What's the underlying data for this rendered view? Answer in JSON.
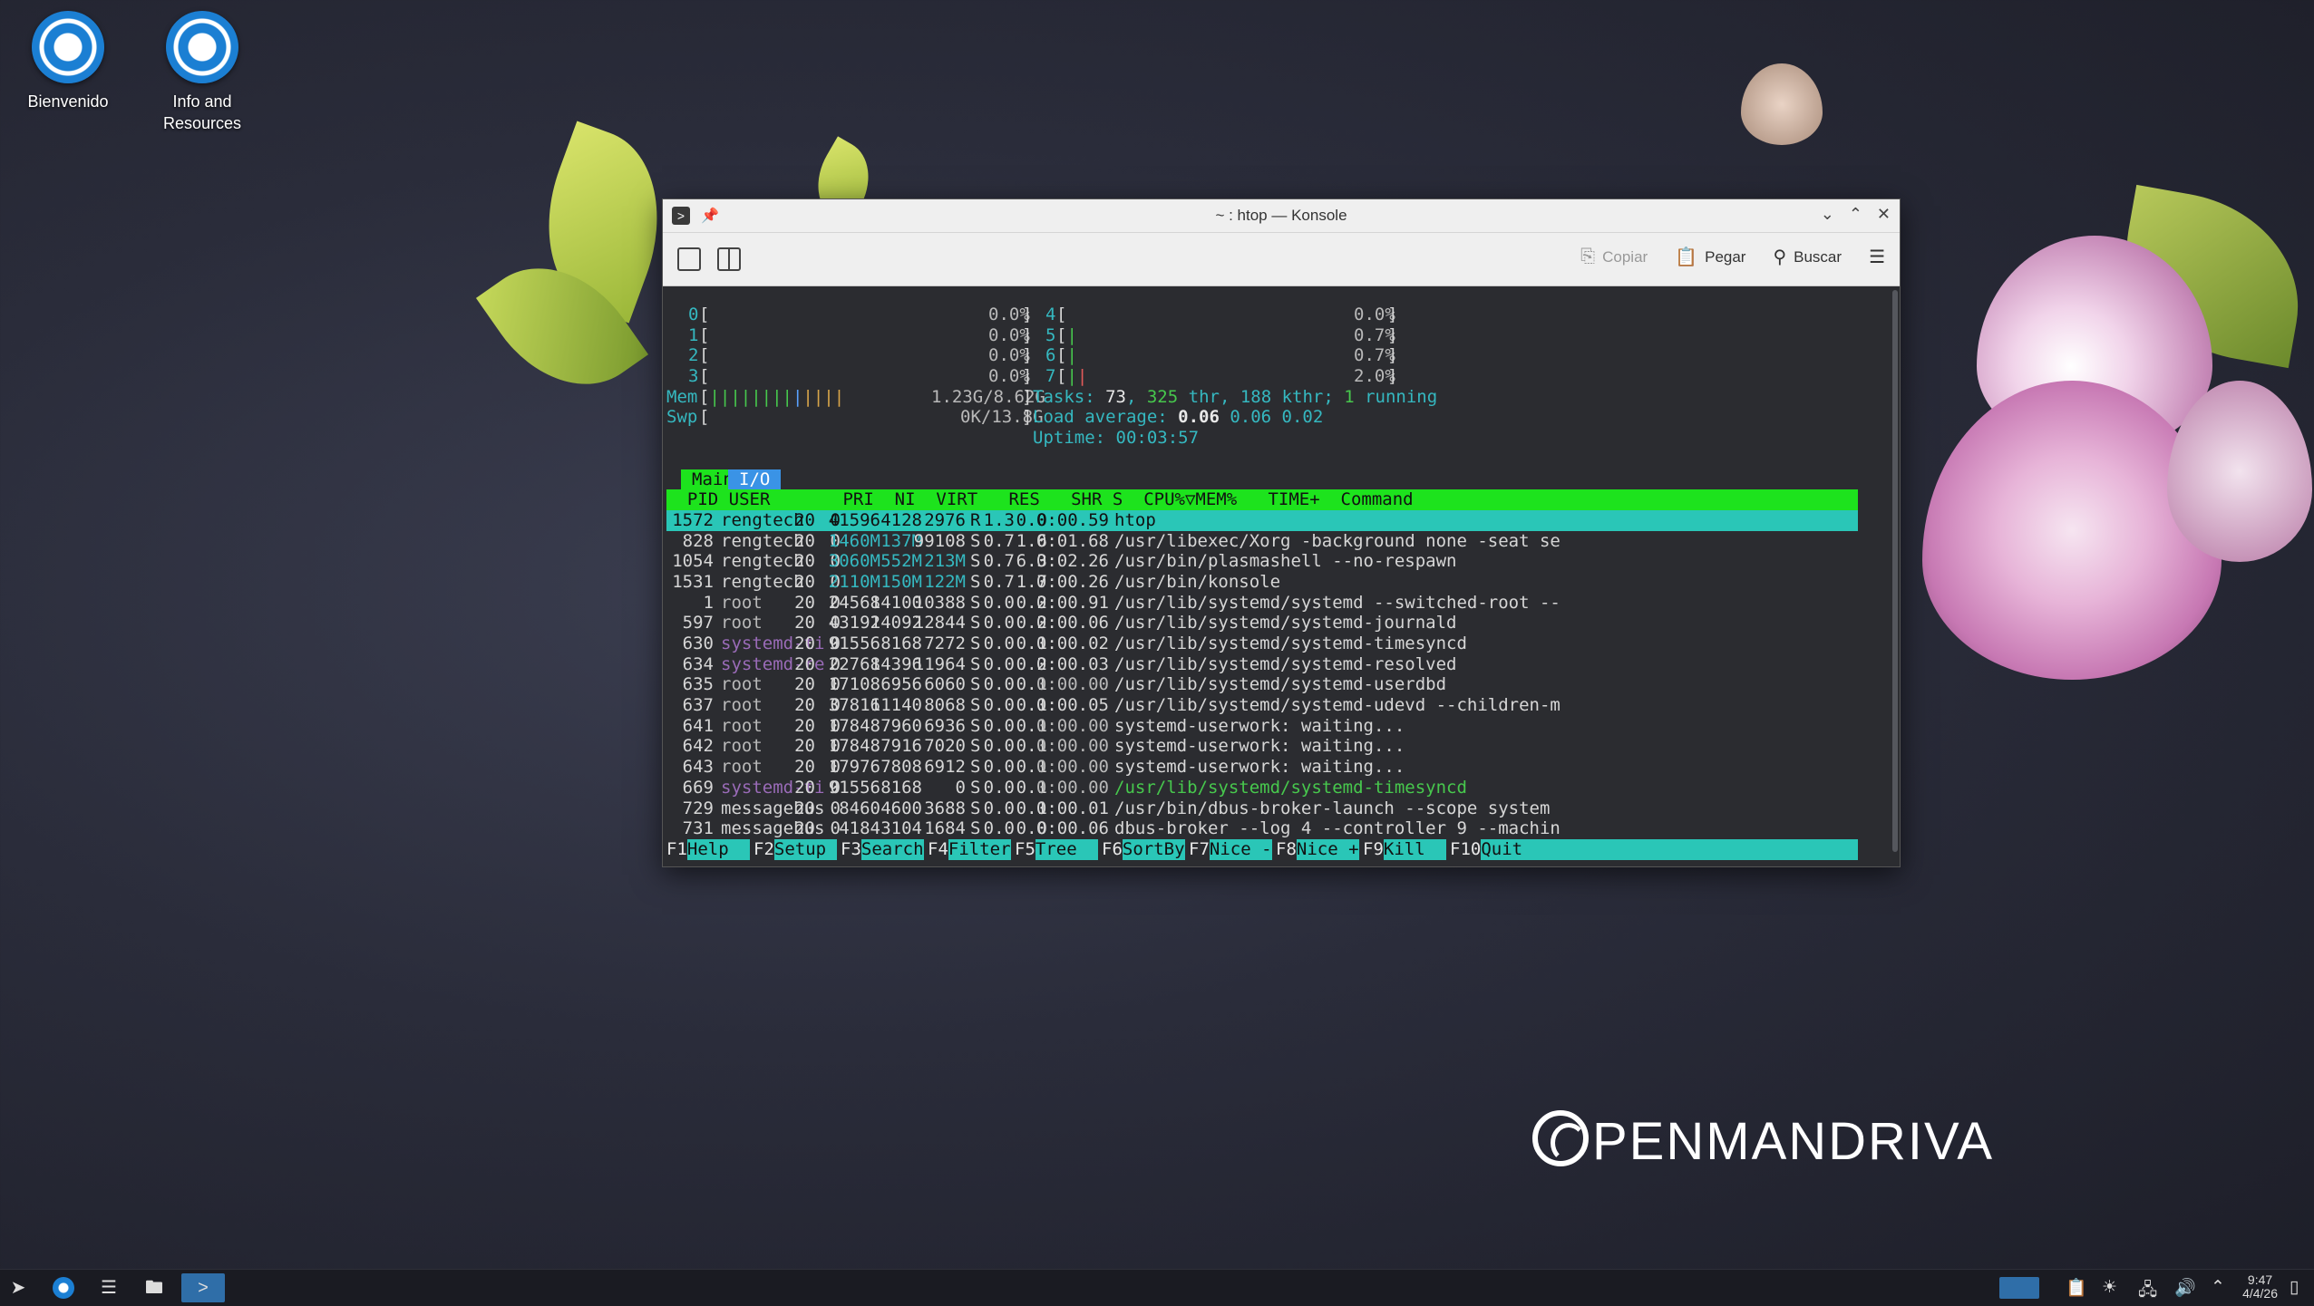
{
  "desktop": {
    "icons": [
      {
        "label": "Bienvenido",
        "icon": "openmandriva-icon"
      },
      {
        "label": "Info and\nResources",
        "icon": "openmandriva-icon"
      }
    ],
    "logo_text": "PENMANDRIVA"
  },
  "window": {
    "title": "~ : htop — Konsole",
    "toolbar": {
      "copy_label": "Copiar",
      "paste_label": "Pegar",
      "search_label": "Buscar"
    }
  },
  "htop": {
    "cpus": [
      {
        "id": "0",
        "pct": "0.0%"
      },
      {
        "id": "1",
        "pct": "0.0%"
      },
      {
        "id": "2",
        "pct": "0.0%"
      },
      {
        "id": "3",
        "pct": "0.0%"
      },
      {
        "id": "4",
        "pct": "0.0%"
      },
      {
        "id": "5",
        "pct": "0.7%"
      },
      {
        "id": "6",
        "pct": "0.7%"
      },
      {
        "id": "7",
        "pct": "2.0%"
      }
    ],
    "mem_label": "Mem",
    "mem_value": "1.23G/8.62G",
    "swp_label": "Swp",
    "swp_value": "0K/13.8G",
    "tasks_prefix": "Tasks: ",
    "tasks_count": "73",
    "thr_count": "325",
    "thr_label": " thr, ",
    "kthr_text": "188 kthr; ",
    "running_count": "1",
    "running_label": " running",
    "load_label": "Load average: ",
    "load_1": "0.06",
    "load_rest": " 0.06 0.02",
    "uptime_label": "Uptime: ",
    "uptime_value": "00:03:57",
    "tabs": [
      "Main",
      "I/O"
    ],
    "header": "  PID USER       PRI  NI  VIRT   RES   SHR S  CPU%▽MEM%   TIME+  Command",
    "processes": [
      {
        "pid": "1572",
        "user": "rengtech",
        "pri": "20",
        "ni": "0",
        "virt": "41596",
        "res": "4128",
        "shr": "2976",
        "s": "R",
        "cpu": "1.3",
        "mem": "0.0",
        "time": "0:00.59",
        "cmd": "htop"
      },
      {
        "pid": "828",
        "user": "rengtech",
        "pri": "20",
        "ni": "0",
        "virt": "1460M",
        "res": "137M",
        "shr": "99108",
        "s": "S",
        "cpu": "0.7",
        "mem": "1.6",
        "time": "0:01.68",
        "cmd": "/usr/libexec/Xorg -background none -seat se"
      },
      {
        "pid": "1054",
        "user": "rengtech",
        "pri": "20",
        "ni": "0",
        "virt": "3060M",
        "res": "552M",
        "shr": "213M",
        "s": "S",
        "cpu": "0.7",
        "mem": "6.3",
        "time": "0:02.26",
        "cmd": "/usr/bin/plasmashell --no-respawn"
      },
      {
        "pid": "1531",
        "user": "rengtech",
        "pri": "20",
        "ni": "0",
        "virt": "2110M",
        "res": "150M",
        "shr": "122M",
        "s": "S",
        "cpu": "0.7",
        "mem": "1.7",
        "time": "0:00.26",
        "cmd": "/usr/bin/konsole"
      },
      {
        "pid": "1",
        "user": "root",
        "pri": "20",
        "ni": "0",
        "virt": "24568",
        "res": "14100",
        "shr": "10388",
        "s": "S",
        "cpu": "0.0",
        "mem": "0.2",
        "time": "0:00.91",
        "cmd": "/usr/lib/systemd/systemd --switched-root --"
      },
      {
        "pid": "597",
        "user": "root",
        "pri": "20",
        "ni": "0",
        "virt": "43192",
        "res": "14092",
        "shr": "12844",
        "s": "S",
        "cpu": "0.0",
        "mem": "0.2",
        "time": "0:00.06",
        "cmd": "/usr/lib/systemd/systemd-journald"
      },
      {
        "pid": "630",
        "user": "systemd-ti",
        "pri": "20",
        "ni": "0",
        "virt": "91556",
        "res": "8168",
        "shr": "7272",
        "s": "S",
        "cpu": "0.0",
        "mem": "0.1",
        "time": "0:00.02",
        "cmd": "/usr/lib/systemd/systemd-timesyncd"
      },
      {
        "pid": "634",
        "user": "systemd-re",
        "pri": "20",
        "ni": "0",
        "virt": "22768",
        "res": "14396",
        "shr": "11964",
        "s": "S",
        "cpu": "0.0",
        "mem": "0.2",
        "time": "0:00.03",
        "cmd": "/usr/lib/systemd/systemd-resolved"
      },
      {
        "pid": "635",
        "user": "root",
        "pri": "20",
        "ni": "0",
        "virt": "17108",
        "res": "6956",
        "shr": "6060",
        "s": "S",
        "cpu": "0.0",
        "mem": "0.1",
        "time": "0:00.00",
        "cmd": "/usr/lib/systemd/systemd-userdbd"
      },
      {
        "pid": "637",
        "user": "root",
        "pri": "20",
        "ni": "0",
        "virt": "37816",
        "res": "11140",
        "shr": "8068",
        "s": "S",
        "cpu": "0.0",
        "mem": "0.1",
        "time": "0:00.05",
        "cmd": "/usr/lib/systemd/systemd-udevd --children-m"
      },
      {
        "pid": "641",
        "user": "root",
        "pri": "20",
        "ni": "0",
        "virt": "17848",
        "res": "7960",
        "shr": "6936",
        "s": "S",
        "cpu": "0.0",
        "mem": "0.1",
        "time": "0:00.00",
        "cmd": "systemd-userwork: waiting..."
      },
      {
        "pid": "642",
        "user": "root",
        "pri": "20",
        "ni": "0",
        "virt": "17848",
        "res": "7916",
        "shr": "7020",
        "s": "S",
        "cpu": "0.0",
        "mem": "0.1",
        "time": "0:00.00",
        "cmd": "systemd-userwork: waiting..."
      },
      {
        "pid": "643",
        "user": "root",
        "pri": "20",
        "ni": "0",
        "virt": "17976",
        "res": "7808",
        "shr": "6912",
        "s": "S",
        "cpu": "0.0",
        "mem": "0.1",
        "time": "0:00.00",
        "cmd": "systemd-userwork: waiting..."
      },
      {
        "pid": "669",
        "user": "systemd-ti",
        "pri": "20",
        "ni": "0",
        "virt": "91556",
        "res": "8168",
        "shr": "0",
        "s": "S",
        "cpu": "0.0",
        "mem": "0.1",
        "time": "0:00.00",
        "cmd": "/usr/lib/systemd/systemd-timesyncd"
      },
      {
        "pid": "729",
        "user": "messagebus",
        "pri": "20",
        "ni": "0",
        "virt": "8460",
        "res": "4600",
        "shr": "3688",
        "s": "S",
        "cpu": "0.0",
        "mem": "0.1",
        "time": "0:00.01",
        "cmd": "/usr/bin/dbus-broker-launch --scope system"
      },
      {
        "pid": "731",
        "user": "messagebus",
        "pri": "20",
        "ni": "0",
        "virt": "4184",
        "res": "3104",
        "shr": "1684",
        "s": "S",
        "cpu": "0.0",
        "mem": "0.0",
        "time": "0:00.06",
        "cmd": "dbus-broker --log 4 --controller 9 --machin"
      }
    ],
    "fkeys": [
      {
        "key": "F1",
        "label": "Help  "
      },
      {
        "key": "F2",
        "label": "Setup "
      },
      {
        "key": "F3",
        "label": "Search"
      },
      {
        "key": "F4",
        "label": "Filter"
      },
      {
        "key": "F5",
        "label": "Tree  "
      },
      {
        "key": "F6",
        "label": "SortBy"
      },
      {
        "key": "F7",
        "label": "Nice -"
      },
      {
        "key": "F8",
        "label": "Nice +"
      },
      {
        "key": "F9",
        "label": "Kill  "
      },
      {
        "key": "F10",
        "label": "Quit"
      }
    ]
  },
  "taskbar": {
    "clock_time": "9:47",
    "clock_date": "4/4/26"
  }
}
